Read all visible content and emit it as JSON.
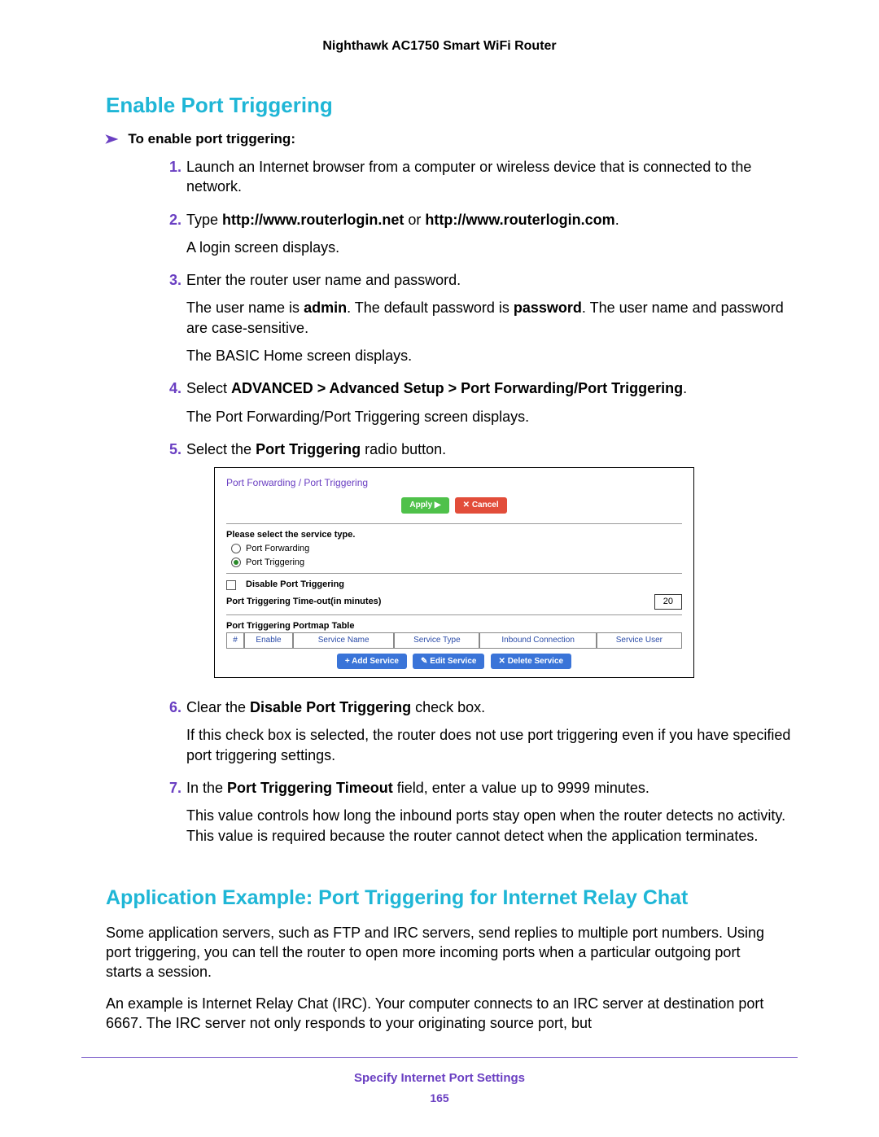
{
  "header": {
    "product": "Nighthawk AC1750 Smart WiFi Router"
  },
  "section1": {
    "heading": "Enable Port Triggering",
    "instr_label": "To enable port triggering:",
    "steps": {
      "s1": {
        "num": "1.",
        "body": "Launch an Internet browser from a computer or wireless device that is connected to the network."
      },
      "s2": {
        "num": "2.",
        "pre": "Type ",
        "url1": "http://www.routerlogin.net",
        "mid": " or ",
        "url2": "http://www.routerlogin.com",
        "post": ".",
        "line2": "A login screen displays."
      },
      "s3": {
        "num": "3.",
        "body": "Enter the router user name and password.",
        "para2_pre": "The user name is ",
        "para2_b1": "admin",
        "para2_mid": ". The default password is ",
        "para2_b2": "password",
        "para2_post": ". The user name and password are case-sensitive.",
        "para3": "The BASIC Home screen displays."
      },
      "s4": {
        "num": "4.",
        "pre": "Select ",
        "bold": "ADVANCED > Advanced Setup > Port Forwarding/Port Triggering",
        "post": ".",
        "line2": "The Port Forwarding/Port Triggering screen displays."
      },
      "s5": {
        "num": "5.",
        "pre": "Select the ",
        "bold": "Port Triggering",
        "post": " radio button."
      },
      "s6": {
        "num": "6.",
        "pre": "Clear the ",
        "bold": "Disable Port Triggering",
        "post": " check box.",
        "line2": "If this check box is selected, the router does not use port triggering even if you have specified port triggering settings."
      },
      "s7": {
        "num": "7.",
        "pre": "In the ",
        "bold": "Port Triggering Timeout",
        "post": " field, enter a value up to 9999 minutes.",
        "line2": "This value controls how long the inbound ports stay open when the router detects no activity. This value is required because the router cannot detect when the application terminates."
      }
    }
  },
  "screenshot": {
    "title": "Port Forwarding / Port Triggering",
    "btn_apply": "Apply ▶",
    "btn_cancel": "✕ Cancel",
    "service_type_label": "Please select the service type.",
    "radio_forwarding": "Port Forwarding",
    "radio_triggering": "Port Triggering",
    "disable_label": "Disable Port Triggering",
    "timeout_label": "Port Triggering Time-out(in minutes)",
    "timeout_value": "20",
    "portmap_label": "Port Triggering Portmap Table",
    "th_hash": "#",
    "th_enable": "Enable",
    "th_sname": "Service Name",
    "th_stype": "Service Type",
    "th_inb": "Inbound Connection",
    "th_suser": "Service User",
    "btn_add": "+ Add Service",
    "btn_edit": "✎ Edit Service",
    "btn_delete": "✕ Delete Service"
  },
  "section2": {
    "heading": "Application Example: Port Triggering for Internet Relay Chat",
    "p1": "Some application servers, such as FTP and IRC servers, send replies to multiple port numbers. Using port triggering, you can tell the router to open more incoming ports when a particular outgoing port starts a session.",
    "p2": "An example is Internet Relay Chat (IRC). Your computer connects to an IRC server at destination port 6667. The IRC server not only responds to your originating source port, but"
  },
  "footer": {
    "title": "Specify Internet Port Settings",
    "page": "165"
  }
}
